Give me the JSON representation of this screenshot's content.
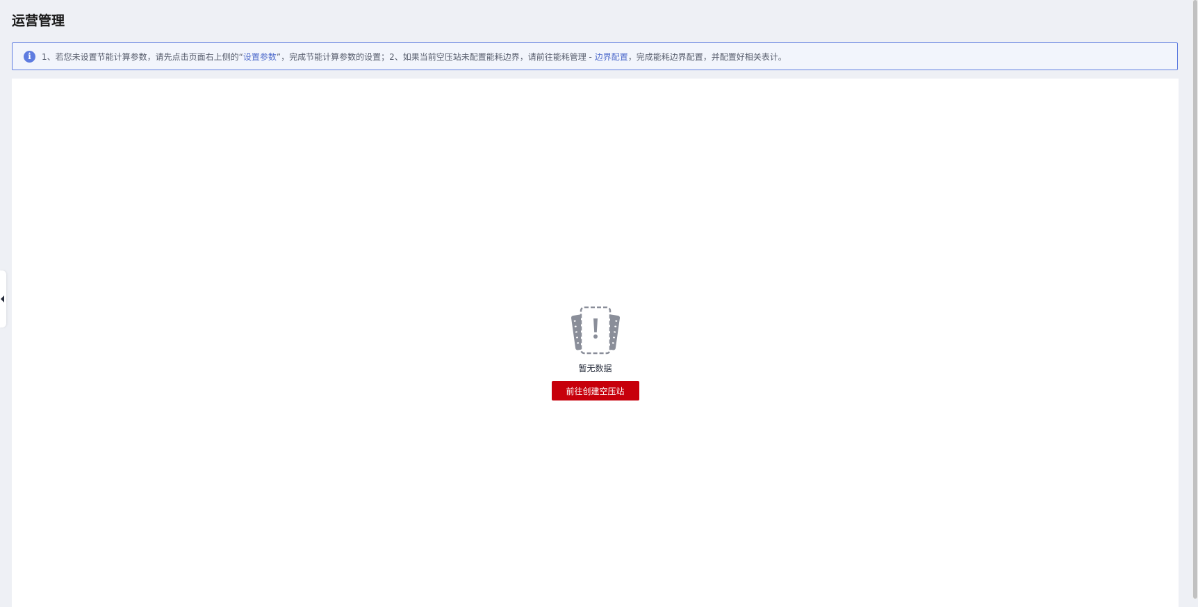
{
  "page": {
    "title": "运营管理"
  },
  "notice": {
    "icon": "info-icon",
    "text_part1": "1、若您未设置节能计算参数，请先点击页面右上侧的“",
    "link1": "设置参数",
    "text_part2": "”，完成节能计算参数的设置；2、如果当前空压站未配置能耗边界，请前往能耗管理 - ",
    "link2": "边界配置",
    "text_part3": "，完成能耗边界配置，并配置好相关表计。"
  },
  "empty_state": {
    "icon": "no-data-icon",
    "text": "暂无数据",
    "button_label": "前往创建空压站"
  },
  "colors": {
    "accent": "#5e7ce0",
    "primary_button": "#c7000b",
    "background": "#eef0f5"
  }
}
